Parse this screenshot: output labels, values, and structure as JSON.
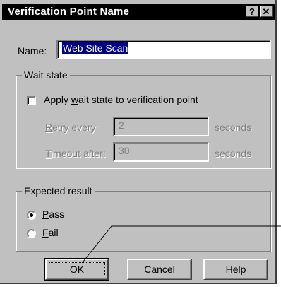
{
  "window": {
    "title": "Verification Point Name",
    "help_btn": "?",
    "close_btn": "✕"
  },
  "name_row": {
    "label": "Name:",
    "value": "Web Site Scan"
  },
  "wait_state": {
    "legend": "Wait state",
    "checkbox_label": "Apply wait state to verification point",
    "retry_label": "Retry every:",
    "retry_value": "2",
    "retry_units": "seconds",
    "timeout_label": "Timeout after:",
    "timeout_value": "30",
    "timeout_units": "seconds"
  },
  "expected_result": {
    "legend": "Expected result",
    "pass_label": "Pass",
    "fail_label": "Fail"
  },
  "buttons": {
    "ok": "OK",
    "cancel": "Cancel",
    "help": "Help"
  }
}
